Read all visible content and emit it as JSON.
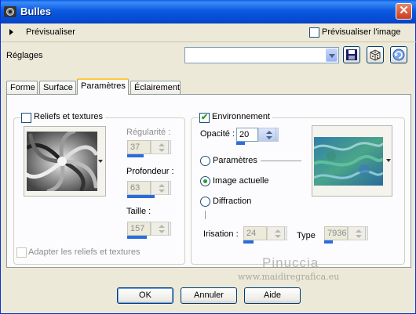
{
  "window": {
    "title": "Bulles"
  },
  "preview": {
    "label": "Prévisualiser",
    "image_checkbox_label": "Prévisualiser l'image",
    "image_checked": false
  },
  "settings": {
    "label": "Réglages",
    "combo_value": ""
  },
  "tabs": [
    {
      "label": "Forme",
      "active": false
    },
    {
      "label": "Surface",
      "active": false
    },
    {
      "label": "Paramètres",
      "active": true
    },
    {
      "label": "Éclairement",
      "active": false
    }
  ],
  "reliefs": {
    "checkbox_label": "Reliefs et textures",
    "checked": false,
    "regularite": {
      "label": "Régularité :",
      "value": "37",
      "level": 0.37
    },
    "profondeur": {
      "label": "Profondeur :",
      "value": "63",
      "level": 0.63
    },
    "taille": {
      "label": "Taille :",
      "value": "157",
      "level": 0.45
    },
    "adapt_label": "Adapter les reliefs et textures",
    "adapt_checked": false
  },
  "environment": {
    "checkbox_label": "Environnement",
    "checked": true,
    "opacite": {
      "label": "Opacité :",
      "value": "20",
      "level": 0.2
    },
    "options": [
      {
        "label": "Paramètres",
        "checked": false
      },
      {
        "label": "Image actuelle",
        "checked": true
      },
      {
        "label": "Diffraction",
        "checked": false
      }
    ],
    "irisation": {
      "label": "Irisation :",
      "value": "24",
      "level": 0.24
    },
    "type": {
      "label": "Type",
      "value": "7936",
      "level": 0.2
    }
  },
  "watermark": {
    "name": "Pinuccia",
    "url": "www.maidiregrafica.eu"
  },
  "buttons": {
    "ok": "OK",
    "cancel": "Annuler",
    "help": "Aide"
  },
  "colors": {
    "titlebar": "#0a5fe5",
    "accent": "#2a6cdc",
    "dialog_bg": "#ece9d8",
    "check": "#21a121"
  }
}
